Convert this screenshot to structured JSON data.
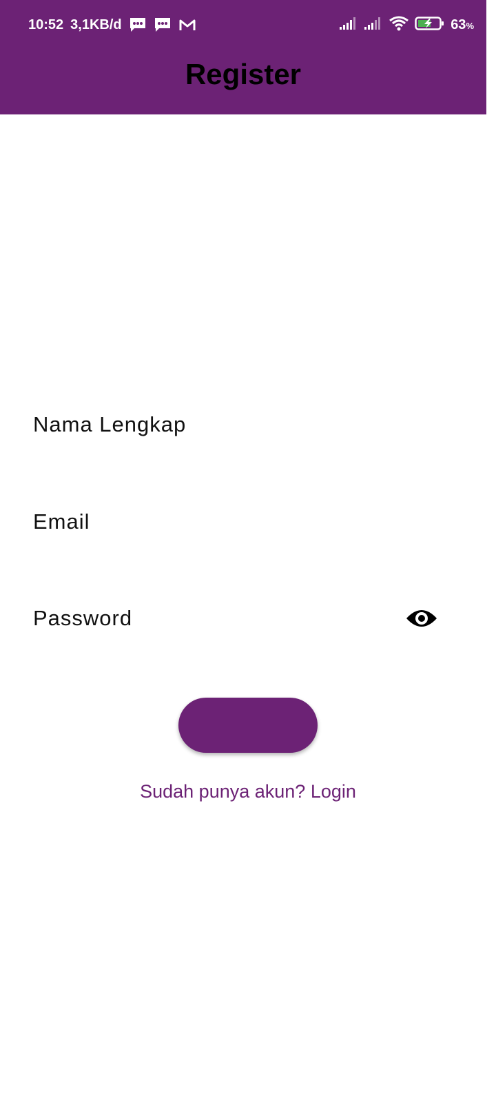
{
  "status_bar": {
    "time": "10:52",
    "net_speed": "3,1KB/d",
    "battery_level": "63",
    "battery_unit": "%",
    "icons": [
      "message-icon",
      "message-icon",
      "gmail-icon",
      "signal-icon",
      "signal-icon",
      "wifi-icon",
      "battery-charging-icon"
    ]
  },
  "app_bar": {
    "title": "Register"
  },
  "form": {
    "full_name": {
      "placeholder": "Nama Lengkap",
      "value": ""
    },
    "email": {
      "placeholder": "Email",
      "value": ""
    },
    "password": {
      "placeholder": "Password",
      "value": "",
      "toggle_icon": "eye-icon"
    },
    "register_button_label": ""
  },
  "login_link": "Sudah punya akun? Login",
  "colors": {
    "primary": "#6c2275",
    "title_text": "#000000",
    "field_text": "#111111",
    "background": "#ffffff"
  }
}
